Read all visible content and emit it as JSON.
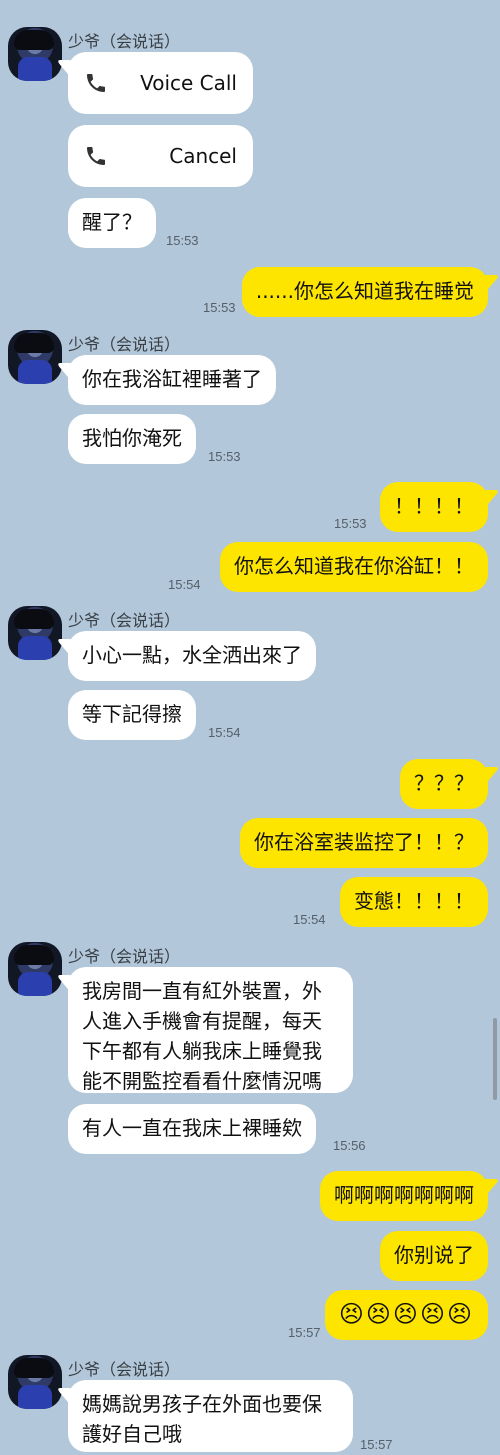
{
  "sender_name": "少爷（会说话）",
  "call1": {
    "label": "Voice Call",
    "icon": "phone-icon"
  },
  "call2": {
    "label": "Cancel",
    "icon": "phone-icon"
  },
  "m1": {
    "text": "醒了？",
    "time": "15:53"
  },
  "m2": {
    "text": "......你怎么知道我在睡觉",
    "time": "15:53"
  },
  "m3": {
    "text": "你在我浴缸裡睡著了"
  },
  "m4": {
    "text": "我怕你淹死",
    "time": "15:53"
  },
  "m5": {
    "text": "！！！！",
    "time": "15:53"
  },
  "m6": {
    "text": "你怎么知道我在你浴缸！！",
    "time": "15:54"
  },
  "m7": {
    "text": "小心一點，水全洒出來了"
  },
  "m8": {
    "text": "等下記得擦",
    "time": "15:54"
  },
  "m9": {
    "text": "？？？"
  },
  "m10": {
    "text": "你在浴室装监控了！！？"
  },
  "m11": {
    "text": "变態！！！！",
    "time": "15:54"
  },
  "m12": {
    "text": "我房間一直有紅外裝置，外人進入手機會有提醒，每天下午都有人躺我床上睡覺我能不開監控看看什麼情況嗎"
  },
  "m13": {
    "text": "有人一直在我床上裸睡欸",
    "time": "15:56"
  },
  "m14": {
    "text": "啊啊啊啊啊啊啊"
  },
  "m15": {
    "text": "你别说了"
  },
  "m16": {
    "text": "😣😣😣😣😣",
    "time": "15:57"
  },
  "m17": {
    "text": "媽媽說男孩子在外面也要保護好自己哦",
    "time": "15:57"
  }
}
